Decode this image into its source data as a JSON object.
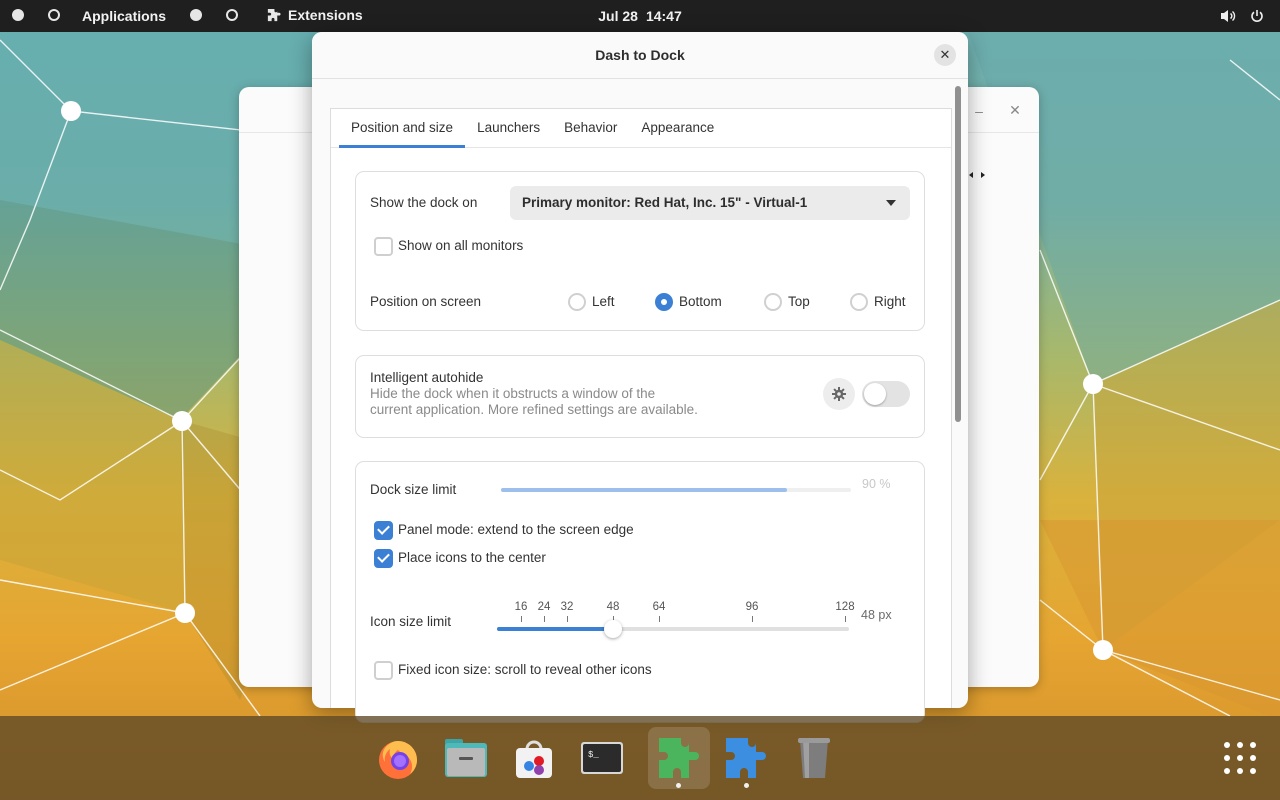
{
  "topbar": {
    "applications_label": "Applications",
    "extensions_label": "Extensions",
    "date": "Jul 28",
    "time": "14:47",
    "icons": [
      "workspace-dot-icon",
      "workspace-ring-icon",
      "puzzle-icon",
      "volume-icon",
      "power-icon"
    ]
  },
  "background_window": {
    "minimize_glyph": "–",
    "close_glyph": "✕"
  },
  "dialog": {
    "title": "Dash to Dock",
    "close_glyph": "✕",
    "tabs": [
      {
        "label": "Position and size",
        "active": true
      },
      {
        "label": "Launchers",
        "active": false
      },
      {
        "label": "Behavior",
        "active": false
      },
      {
        "label": "Appearance",
        "active": false
      }
    ],
    "position": {
      "show_dock_label": "Show the dock on",
      "monitor_selected": "Primary monitor: Red Hat, Inc. 15\" - Virtual-1",
      "all_monitors_label": "Show on all monitors",
      "all_monitors_checked": false,
      "position_label": "Position on screen",
      "options": [
        {
          "label": "Left",
          "checked": false
        },
        {
          "label": "Bottom",
          "checked": true
        },
        {
          "label": "Top",
          "checked": false
        },
        {
          "label": "Right",
          "checked": false
        }
      ]
    },
    "autohide": {
      "title": "Intelligent autohide",
      "description_line1": "Hide the dock when it obstructs a window of the",
      "description_line2": "current application. More refined settings are available.",
      "enabled": false
    },
    "size": {
      "dock_size_label": "Dock size limit",
      "dock_size_value": "90 %",
      "dock_size_fraction": 0.9,
      "panel_mode_label": "Panel mode: extend to the screen edge",
      "panel_mode_checked": true,
      "center_icons_label": "Place icons to the center",
      "center_icons_checked": true,
      "icon_size_label": "Icon size limit",
      "icon_size_value": "48 px",
      "icon_size": 48,
      "icon_ticks": [
        "16",
        "24",
        "32",
        "48",
        "64",
        "96",
        "128"
      ],
      "fixed_icon_label": "Fixed icon size: scroll to reveal other icons",
      "fixed_icon_checked": false
    }
  },
  "dock": {
    "apps": [
      {
        "name": "Firefox",
        "icon": "firefox-icon",
        "running": false
      },
      {
        "name": "Files",
        "icon": "files-icon",
        "running": false
      },
      {
        "name": "Software",
        "icon": "software-store-icon",
        "running": false
      },
      {
        "name": "Terminal",
        "icon": "terminal-icon",
        "running": false
      },
      {
        "name": "Extension Manager",
        "icon": "green-puzzle-icon",
        "running": true,
        "active": true
      },
      {
        "name": "Extensions",
        "icon": "blue-puzzle-icon",
        "running": true
      },
      {
        "name": "Trash",
        "icon": "trash-icon",
        "running": false
      }
    ],
    "terminal_prompt": "$_",
    "show_apps_icon": "app-grid-icon"
  }
}
